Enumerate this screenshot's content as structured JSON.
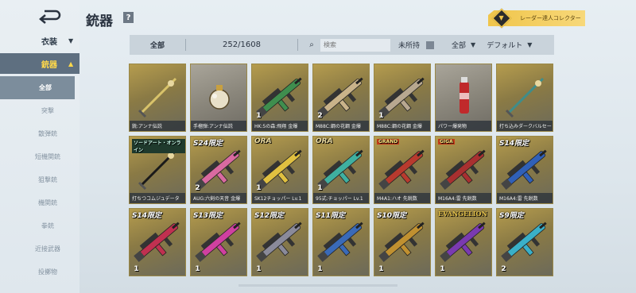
{
  "sidebar": {
    "outfit_label": "衣装",
    "weapons_label": "銃器",
    "sub_items": [
      {
        "label": "全部",
        "active": true
      },
      {
        "label": "突撃"
      },
      {
        "label": "散弾銃"
      },
      {
        "label": "短機関銃"
      },
      {
        "label": "狙撃銃"
      },
      {
        "label": "機関銃"
      },
      {
        "label": "拳銃"
      },
      {
        "label": "近接武器"
      },
      {
        "label": "投擲物"
      }
    ]
  },
  "header": {
    "title": "銃器",
    "help_glyph": "?",
    "collector_label": "レーダー達人コレクター"
  },
  "filter": {
    "all_label": "全部",
    "count": "252/1608",
    "search_placeholder": "検索",
    "unowned_label": "未所持",
    "type_dropdown": "全部",
    "sort_dropdown": "デフォルト"
  },
  "cards": [
    {
      "name": "銃:アンナ伝説",
      "tag": "",
      "badge": "",
      "color": "#d9c36a"
    },
    {
      "name": "手榴弾:アンナ伝説",
      "tag": "",
      "badge": "",
      "color": "#e8e0c8"
    },
    {
      "name": "HK:5の森:飛翔 金爆",
      "tag": "",
      "badge": "1",
      "color": "#3f8e4e"
    },
    {
      "name": "M88C:鋼の花鋼 金爆",
      "tag": "",
      "badge": "2",
      "color": "#c9b38a"
    },
    {
      "name": "M88C:鋼の花鋼 金爆",
      "tag": "",
      "badge": "1",
      "color": "#b8a890"
    },
    {
      "name": "パワー爆発物",
      "tag": "",
      "badge": "",
      "color": "#c0292b"
    },
    {
      "name": "打ち込みダークバルセー",
      "tag": "",
      "badge": "",
      "color": "#3f8d8a"
    },
    {
      "name": "打ちつコムジュデータ",
      "tag": "ソードアート・オンライン",
      "tagtype": "label",
      "badge": "",
      "color": "#1a1a1a"
    },
    {
      "name": "AUG:六剣の天音 金爆",
      "tag": "S24限定",
      "badge": "2",
      "color": "#d96aa0"
    },
    {
      "name": "SK12チョッパー Lv.1",
      "tag": "ORA",
      "tagtype": "red",
      "badge": "1",
      "color": "#e0c040"
    },
    {
      "name": "95式:チョッパー Lv.1",
      "tag": "ORA",
      "tagtype": "red",
      "badge": "1",
      "color": "#3fb0a0"
    },
    {
      "name": "M4A1:ハオ 先鋭数",
      "tag": "GRAND",
      "tagtype": "logo",
      "badge": "",
      "color": "#b83a2e"
    },
    {
      "name": "M16A4:雷 先鋭数",
      "tag": "GIGA",
      "tagtype": "logo",
      "badge": "",
      "color": "#a83030"
    },
    {
      "name": "M16A4:雷 先鋭数",
      "tag": "S14限定",
      "badge": "",
      "color": "#3060b8"
    },
    {
      "name": "",
      "tag": "S14限定",
      "badge": "1",
      "color": "#c03050"
    },
    {
      "name": "",
      "tag": "S13限定",
      "badge": "1",
      "color": "#d040a0"
    },
    {
      "name": "",
      "tag": "S12限定",
      "badge": "1",
      "color": "#8a8a9a"
    },
    {
      "name": "",
      "tag": "S11限定",
      "badge": "1",
      "color": "#3a6ab8"
    },
    {
      "name": "",
      "tag": "S10限定",
      "badge": "1",
      "color": "#c09030"
    },
    {
      "name": "",
      "tag": "EVANGELION",
      "tagtype": "evangelion",
      "badge": "1",
      "color": "#7a3ab0"
    },
    {
      "name": "",
      "tag": "S9限定",
      "badge": "2",
      "color": "#3ab0c8"
    }
  ]
}
